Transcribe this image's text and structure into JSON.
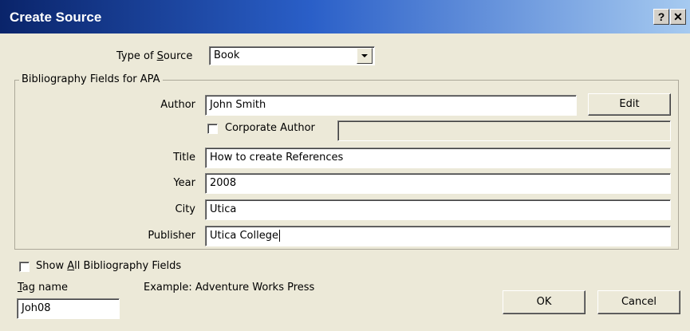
{
  "window": {
    "title": "Create Source",
    "help_label": "?",
    "close_label": "✕"
  },
  "type_of_source": {
    "label_before": "Type of ",
    "label_underline": "S",
    "label_after": "ource",
    "value": "Book"
  },
  "group": {
    "label": "Bibliography Fields for APA"
  },
  "fields": {
    "author": {
      "label": "Author",
      "value": "John Smith",
      "edit_label": "Edit"
    },
    "corporate_author": {
      "label": "Corporate Author",
      "checked": false,
      "value": ""
    },
    "title": {
      "label": "Title",
      "value": "How to create References"
    },
    "year": {
      "label": "Year",
      "value": "2008"
    },
    "city": {
      "label": "City",
      "value": "Utica"
    },
    "publisher": {
      "label": "Publisher",
      "value": "Utica College"
    }
  },
  "show_all": {
    "label_before": "Show ",
    "label_underline": "A",
    "label_after": "ll Bibliography Fields",
    "checked": false
  },
  "tag_name": {
    "label_underline": "T",
    "label_after": "ag name",
    "value": "Joh08"
  },
  "example": "Example: Adventure Works Press",
  "buttons": {
    "ok": "OK",
    "cancel": "Cancel"
  }
}
